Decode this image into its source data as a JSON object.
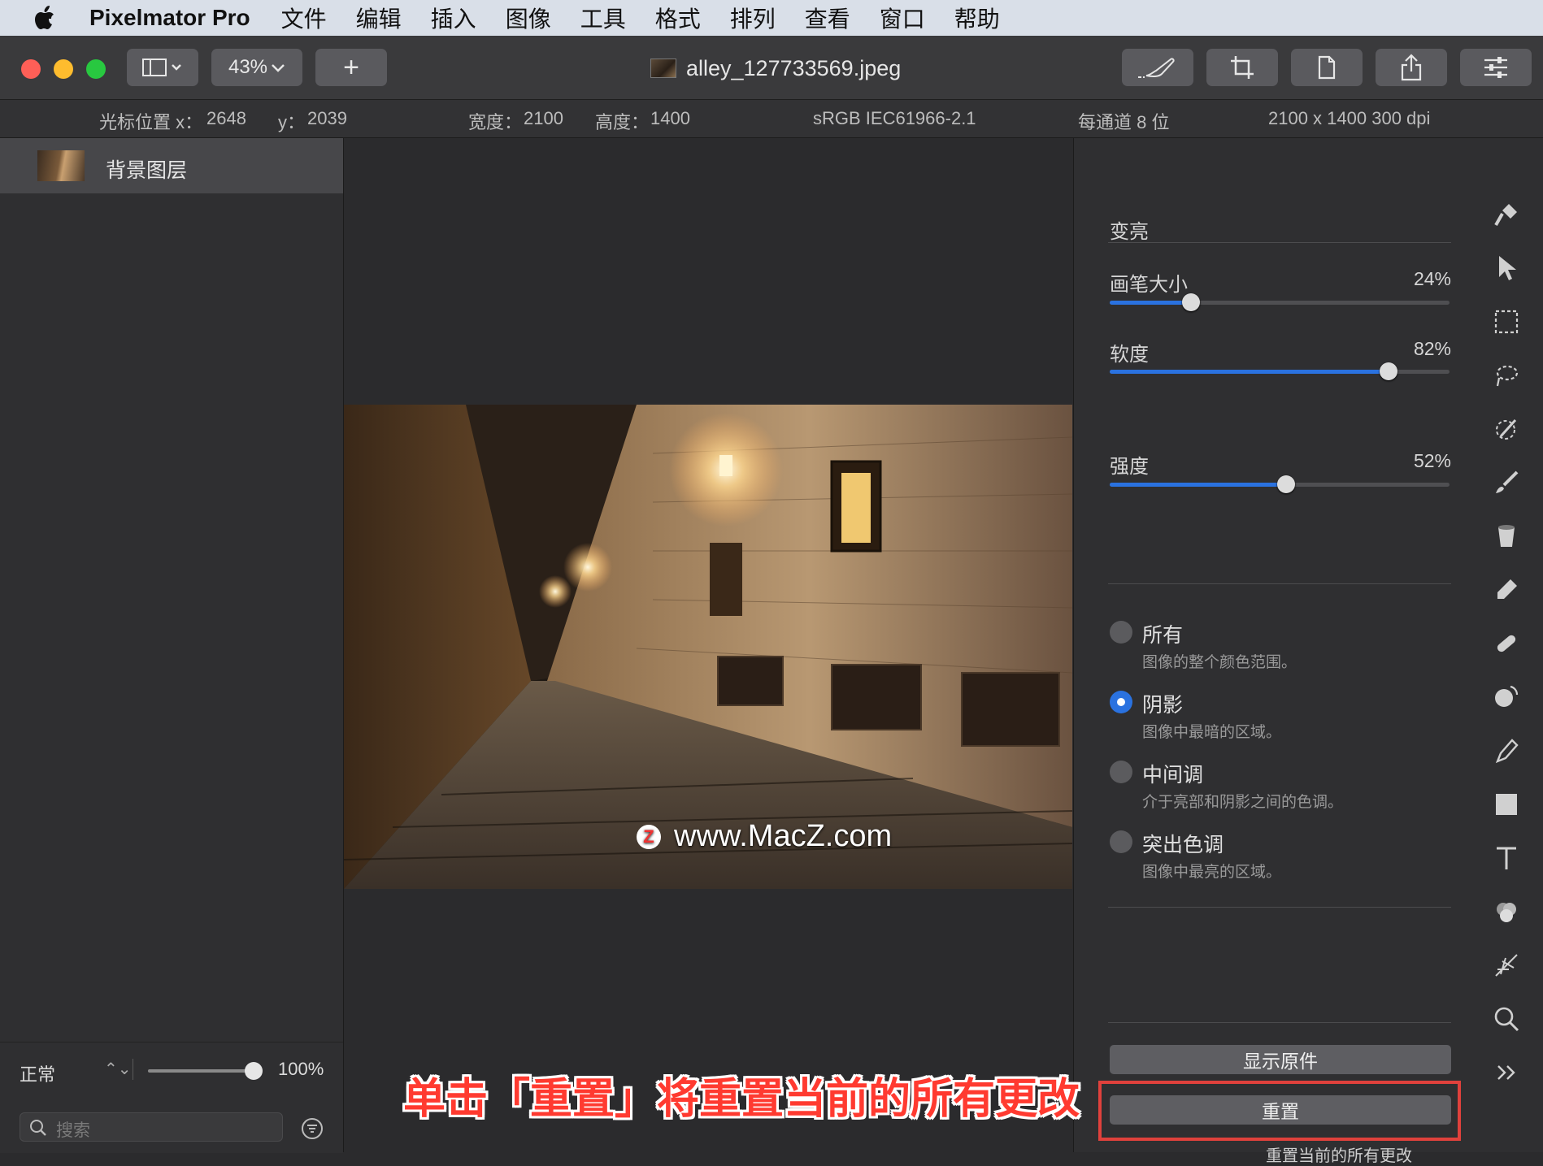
{
  "menubar": {
    "app_name": "Pixelmator Pro",
    "menus": [
      "文件",
      "编辑",
      "插入",
      "图像",
      "工具",
      "格式",
      "排列",
      "查看",
      "窗口",
      "帮助"
    ]
  },
  "toolbar": {
    "zoom": "43%",
    "add_label": "+",
    "document_title": "alley_127733569.jpeg"
  },
  "infobar": {
    "cursor_x_label": "光标位置 x：",
    "cursor_x": "2648",
    "cursor_y_label": "y：",
    "cursor_y": "2039",
    "width_label": "宽度：",
    "width": "2100",
    "height_label": "高度：",
    "height": "1400",
    "color_profile": "sRGB IEC61966-2.1",
    "bit_depth": "每通道 8 位",
    "dimensions": "2100 x 1400 300 dpi"
  },
  "layers": {
    "items": [
      {
        "name": "背景图层"
      }
    ],
    "blend_mode": "正常",
    "opacity": "100%",
    "opacity_fraction": 1.0,
    "search_placeholder": "搜索"
  },
  "canvas": {
    "watermark": "www.MacZ.com",
    "watermark_logo": "Z"
  },
  "adjust": {
    "tool_title": "变亮",
    "sliders": [
      {
        "label": "画笔大小",
        "value": "24%",
        "fraction": 0.24
      },
      {
        "label": "软度",
        "value": "82%",
        "fraction": 0.82
      },
      {
        "label": "强度",
        "value": "52%",
        "fraction": 0.52
      }
    ],
    "ranges": [
      {
        "label": "所有",
        "desc": "图像的整个颜色范围。",
        "selected": false
      },
      {
        "label": "阴影",
        "desc": "图像中最暗的区域。",
        "selected": true
      },
      {
        "label": "中间调",
        "desc": "介于亮部和阴影之间的色调。",
        "selected": false
      },
      {
        "label": "突出色调",
        "desc": "图像中最亮的区域。",
        "selected": false
      }
    ],
    "show_original": "显示原件",
    "reset": "重置",
    "reset_tooltip": "重置当前的所有更改"
  },
  "tools": [
    "paint-roller-icon",
    "arrow-select-icon",
    "rect-select-icon",
    "lasso-icon",
    "magic-wand-icon",
    "brush-icon",
    "bucket-icon",
    "eraser-icon",
    "bandage-icon",
    "clone-icon",
    "pen-icon",
    "shape-icon",
    "text-icon",
    "color-adjust-icon",
    "distort-icon",
    "zoom-icon",
    "more-icon"
  ],
  "caption": "单击「重置」将重置当前的所有更改",
  "colors": {
    "accent": "#2a72e0",
    "highlight": "#e0413c",
    "caption": "#ff3a30"
  }
}
